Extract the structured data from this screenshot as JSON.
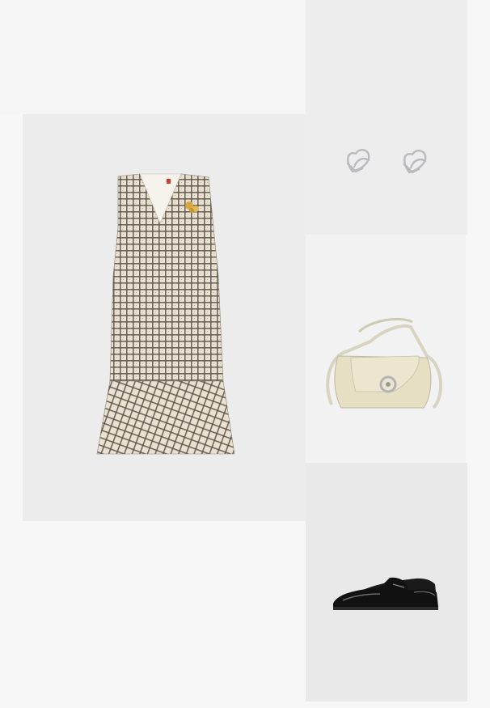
{
  "collage": {
    "items": [
      {
        "id": "dress",
        "icon": "checked-dress-icon",
        "color": "#e6dfcf"
      },
      {
        "id": "earrings",
        "icon": "heart-earrings-icon",
        "color": "#c9c9cb"
      },
      {
        "id": "bag",
        "icon": "handbag-icon",
        "color": "#e8e1c8"
      },
      {
        "id": "loafers",
        "icon": "loafer-shoe-icon",
        "color": "#111111"
      }
    ],
    "colors": {
      "page_bg": "#f7f7f7",
      "panel_bg": "#ececec",
      "check_dark": "#4a4238",
      "brooch_gold": "#d7a83c"
    }
  }
}
